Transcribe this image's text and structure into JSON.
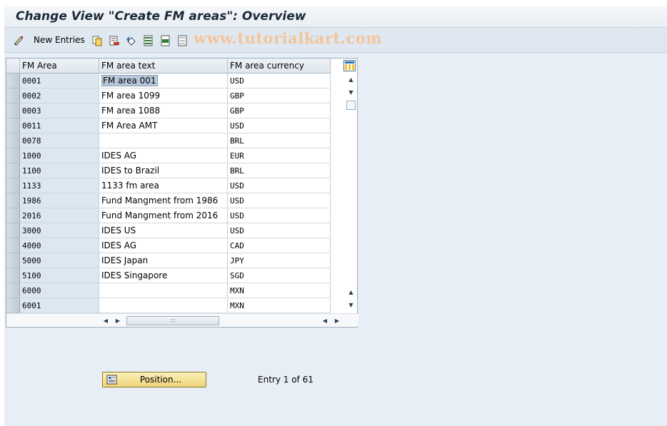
{
  "window": {
    "title": "Change View \"Create FM areas\": Overview"
  },
  "toolbar": {
    "new_entries_label": "New Entries",
    "watermark": "www.tutorialkart.com",
    "icons": [
      "edit-pencil-icon",
      "copy-icon",
      "delete-icon",
      "undo-icon",
      "select-all-icon",
      "select-block-icon",
      "deselect-all-icon"
    ]
  },
  "table": {
    "columns": [
      "FM Area",
      "FM area text",
      "FM area currency"
    ],
    "rows": [
      {
        "area": "0001",
        "text": "FM area 001",
        "currency": "USD"
      },
      {
        "area": "0002",
        "text": "FM area 1099",
        "currency": "GBP"
      },
      {
        "area": "0003",
        "text": "FM area 1088",
        "currency": "GBP"
      },
      {
        "area": "0011",
        "text": "FM Area AMT",
        "currency": "USD"
      },
      {
        "area": "0078",
        "text": "",
        "currency": "BRL"
      },
      {
        "area": "1000",
        "text": "IDES AG",
        "currency": "EUR"
      },
      {
        "area": "1100",
        "text": "IDES to Brazil",
        "currency": "BRL"
      },
      {
        "area": "1133",
        "text": "1133 fm area",
        "currency": "USD"
      },
      {
        "area": "1986",
        "text": "Fund Mangment from 1986",
        "currency": "USD"
      },
      {
        "area": "2016",
        "text": "Fund Mangment from 2016",
        "currency": "USD"
      },
      {
        "area": "3000",
        "text": "IDES US",
        "currency": "USD"
      },
      {
        "area": "4000",
        "text": "IDES AG",
        "currency": "CAD"
      },
      {
        "area": "5000",
        "text": "IDES Japan",
        "currency": "JPY"
      },
      {
        "area": "5100",
        "text": "IDES Singapore",
        "currency": "SGD"
      },
      {
        "area": "6000",
        "text": "",
        "currency": "MXN"
      },
      {
        "area": "6001",
        "text": "",
        "currency": "MXN"
      }
    ],
    "selected_row": 0
  },
  "footer": {
    "position_button_label": "Position...",
    "entry_info": "Entry 1 of 61"
  },
  "colors": {
    "background": "#e7eef5",
    "key_column": "#dde7f1",
    "position_button": "#f4e08e"
  }
}
